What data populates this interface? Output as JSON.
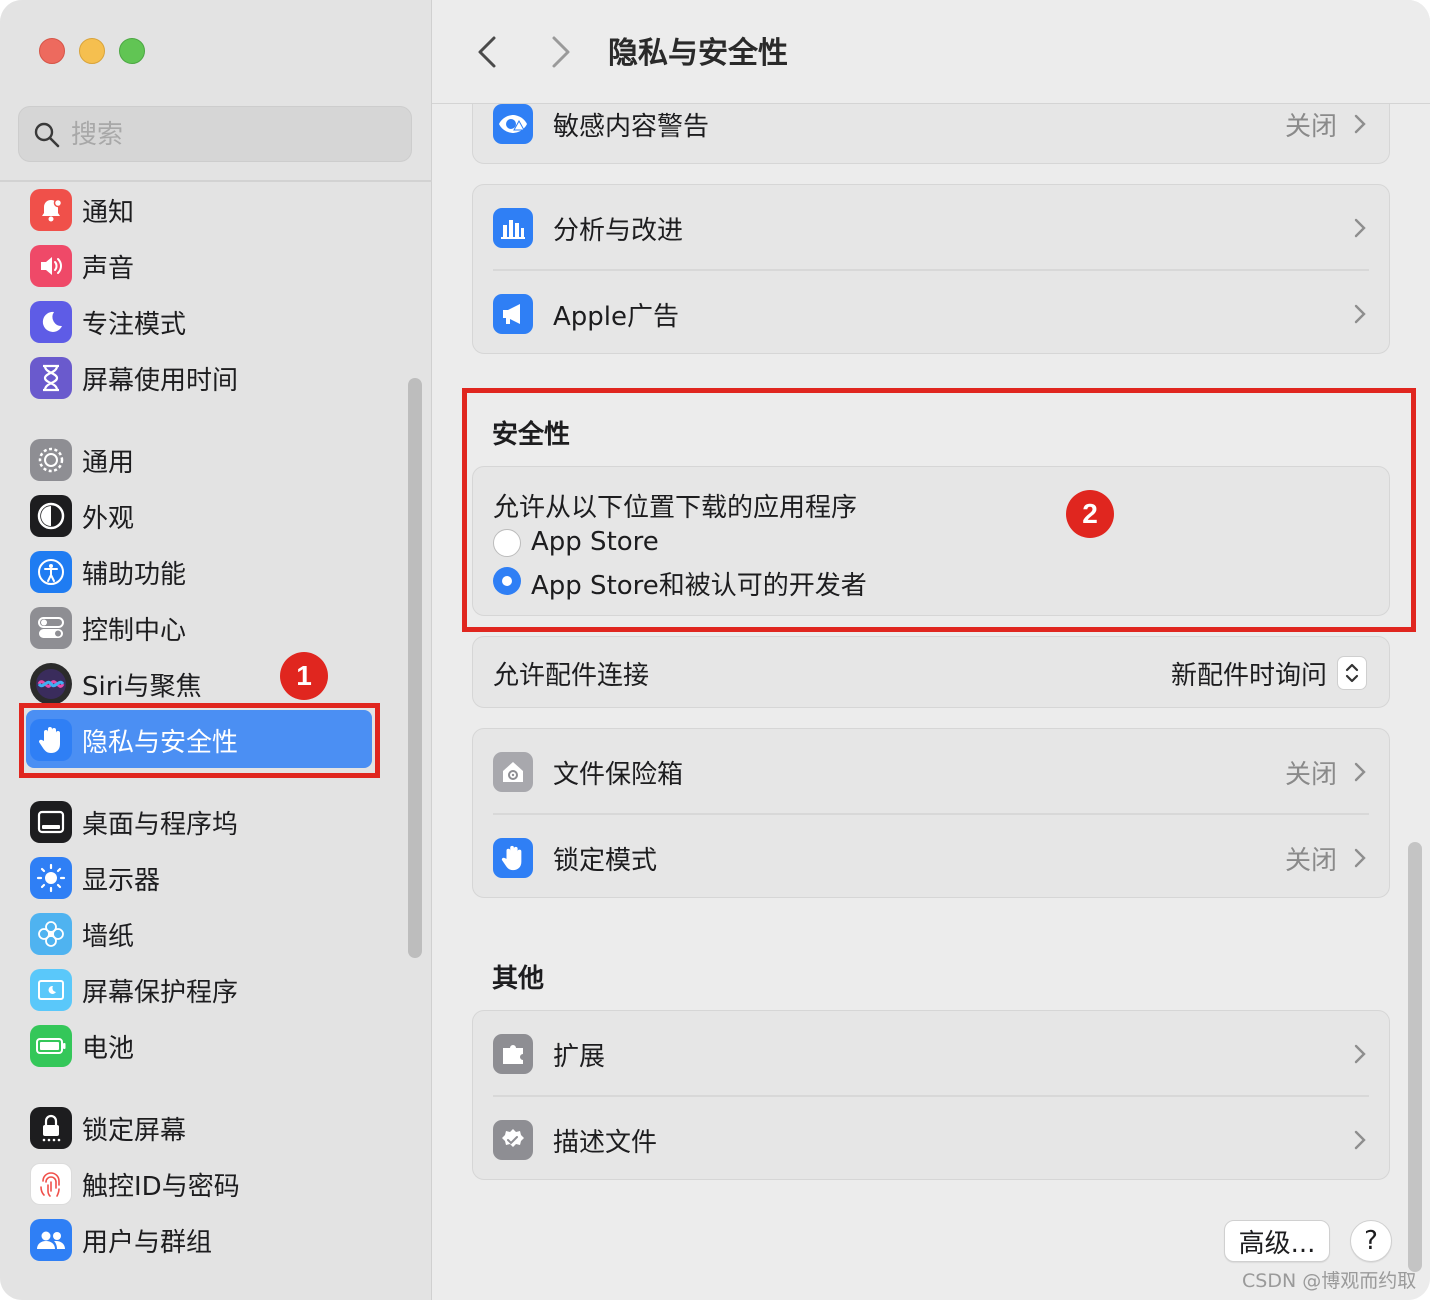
{
  "window": {
    "title": "隐私与安全性"
  },
  "search": {
    "placeholder": "搜索"
  },
  "sidebar": {
    "items": [
      {
        "label": "通知",
        "icon": "bell-icon",
        "color": "#f0504a"
      },
      {
        "label": "声音",
        "icon": "speaker-icon",
        "color": "#ef4968"
      },
      {
        "label": "专注模式",
        "icon": "moon-icon",
        "color": "#5e5ce6"
      },
      {
        "label": "屏幕使用时间",
        "icon": "hourglass-icon",
        "color": "#6a5acd"
      },
      {
        "label": "通用",
        "icon": "gear-icon",
        "color": "#8e8e93"
      },
      {
        "label": "外观",
        "icon": "appearance-icon",
        "color": "#1d1d1f"
      },
      {
        "label": "辅助功能",
        "icon": "accessibility-icon",
        "color": "#1f7cf2"
      },
      {
        "label": "控制中心",
        "icon": "toggles-icon",
        "color": "#8e8e93"
      },
      {
        "label": "Siri与聚焦",
        "icon": "siri-icon",
        "color": "#2b2b2b"
      },
      {
        "label": "隐私与安全性",
        "icon": "hand-icon",
        "color": "#2f7ff5",
        "selected": true
      },
      {
        "label": "桌面与程序坞",
        "icon": "dock-icon",
        "color": "#1d1d1f"
      },
      {
        "label": "显示器",
        "icon": "sun-icon",
        "color": "#2f7ff5"
      },
      {
        "label": "墙纸",
        "icon": "flower-icon",
        "color": "#4fb3f0"
      },
      {
        "label": "屏幕保护程序",
        "icon": "screensaver-icon",
        "color": "#5ac8fa"
      },
      {
        "label": "电池",
        "icon": "battery-icon",
        "color": "#34c759"
      },
      {
        "label": "锁定屏幕",
        "icon": "lock-icon",
        "color": "#1d1d1f"
      },
      {
        "label": "触控ID与密码",
        "icon": "fingerprint-icon",
        "color": "#ffffff"
      },
      {
        "label": "用户与群组",
        "icon": "users-icon",
        "color": "#2f7ff5"
      }
    ]
  },
  "main": {
    "rows_top": [
      {
        "label": "敏感内容警告",
        "value": "关闭",
        "icon": "eye-warning-icon"
      }
    ],
    "rows_analytics": [
      {
        "label": "分析与改进",
        "icon": "chart-icon"
      },
      {
        "label": "Apple广告",
        "icon": "megaphone-icon"
      }
    ],
    "security": {
      "title": "安全性",
      "prompt": "允许从以下位置下载的应用程序",
      "options": [
        {
          "label": "App Store",
          "selected": false
        },
        {
          "label": "App Store和被认可的开发者",
          "selected": true
        }
      ]
    },
    "accessories": {
      "label": "允许配件连接",
      "value": "新配件时询问"
    },
    "rows_vault": [
      {
        "label": "文件保险箱",
        "value": "关闭",
        "icon": "house-safe-icon"
      },
      {
        "label": "锁定模式",
        "value": "关闭",
        "icon": "hand-icon"
      }
    ],
    "other": {
      "title": "其他",
      "rows": [
        {
          "label": "扩展",
          "icon": "puzzle-icon"
        },
        {
          "label": "描述文件",
          "icon": "badge-check-icon"
        }
      ]
    },
    "buttons": {
      "advanced": "高级...",
      "help": "?"
    }
  },
  "annotations": {
    "badge1": "1",
    "badge2": "2"
  },
  "watermark": "CSDN @博观而约取",
  "colors": {
    "accent": "#2f7ff5",
    "selection": "#4b8ff3",
    "annotation": "#e0261f"
  }
}
